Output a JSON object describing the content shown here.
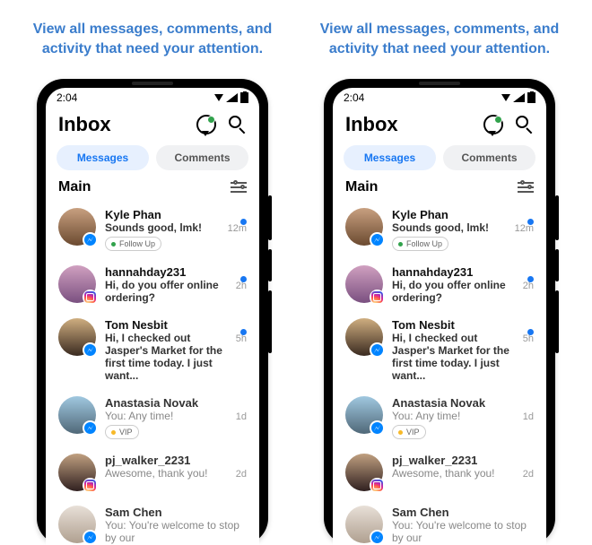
{
  "caption": "View all messages, comments, and activity that need your attention.",
  "statusbar": {
    "time": "2:04"
  },
  "header": {
    "title": "Inbox"
  },
  "tabs": {
    "messages": "Messages",
    "comments": "Comments"
  },
  "section": {
    "title": "Main"
  },
  "threads": [
    {
      "name": "Kyle Phan",
      "message": "Sounds good, lmk!",
      "time": "12m",
      "unread": true,
      "tag": "Follow Up",
      "source": "messenger",
      "avatar": "av1"
    },
    {
      "name": "hannahday231",
      "message": "Hi, do you offer online ordering?",
      "time": "2h",
      "unread": true,
      "source": "instagram",
      "avatar": "av2"
    },
    {
      "name": "Tom Nesbit",
      "message": "Hi, I checked out Jasper's Market for the first time today. I just want...",
      "time": "5h",
      "unread": true,
      "source": "messenger",
      "avatar": "av3"
    },
    {
      "name": "Anastasia Novak",
      "message": "You: Any time!",
      "time": "1d",
      "unread": false,
      "tag": "VIP",
      "source": "messenger",
      "avatar": "av4"
    },
    {
      "name": "pj_walker_2231",
      "message": "Awesome, thank you!",
      "time": "2d",
      "unread": false,
      "source": "instagram",
      "avatar": "av5"
    },
    {
      "name": "Sam Chen",
      "message": "You: You're welcome to stop by our",
      "time": "",
      "unread": false,
      "source": "messenger",
      "avatar": "av6"
    }
  ]
}
